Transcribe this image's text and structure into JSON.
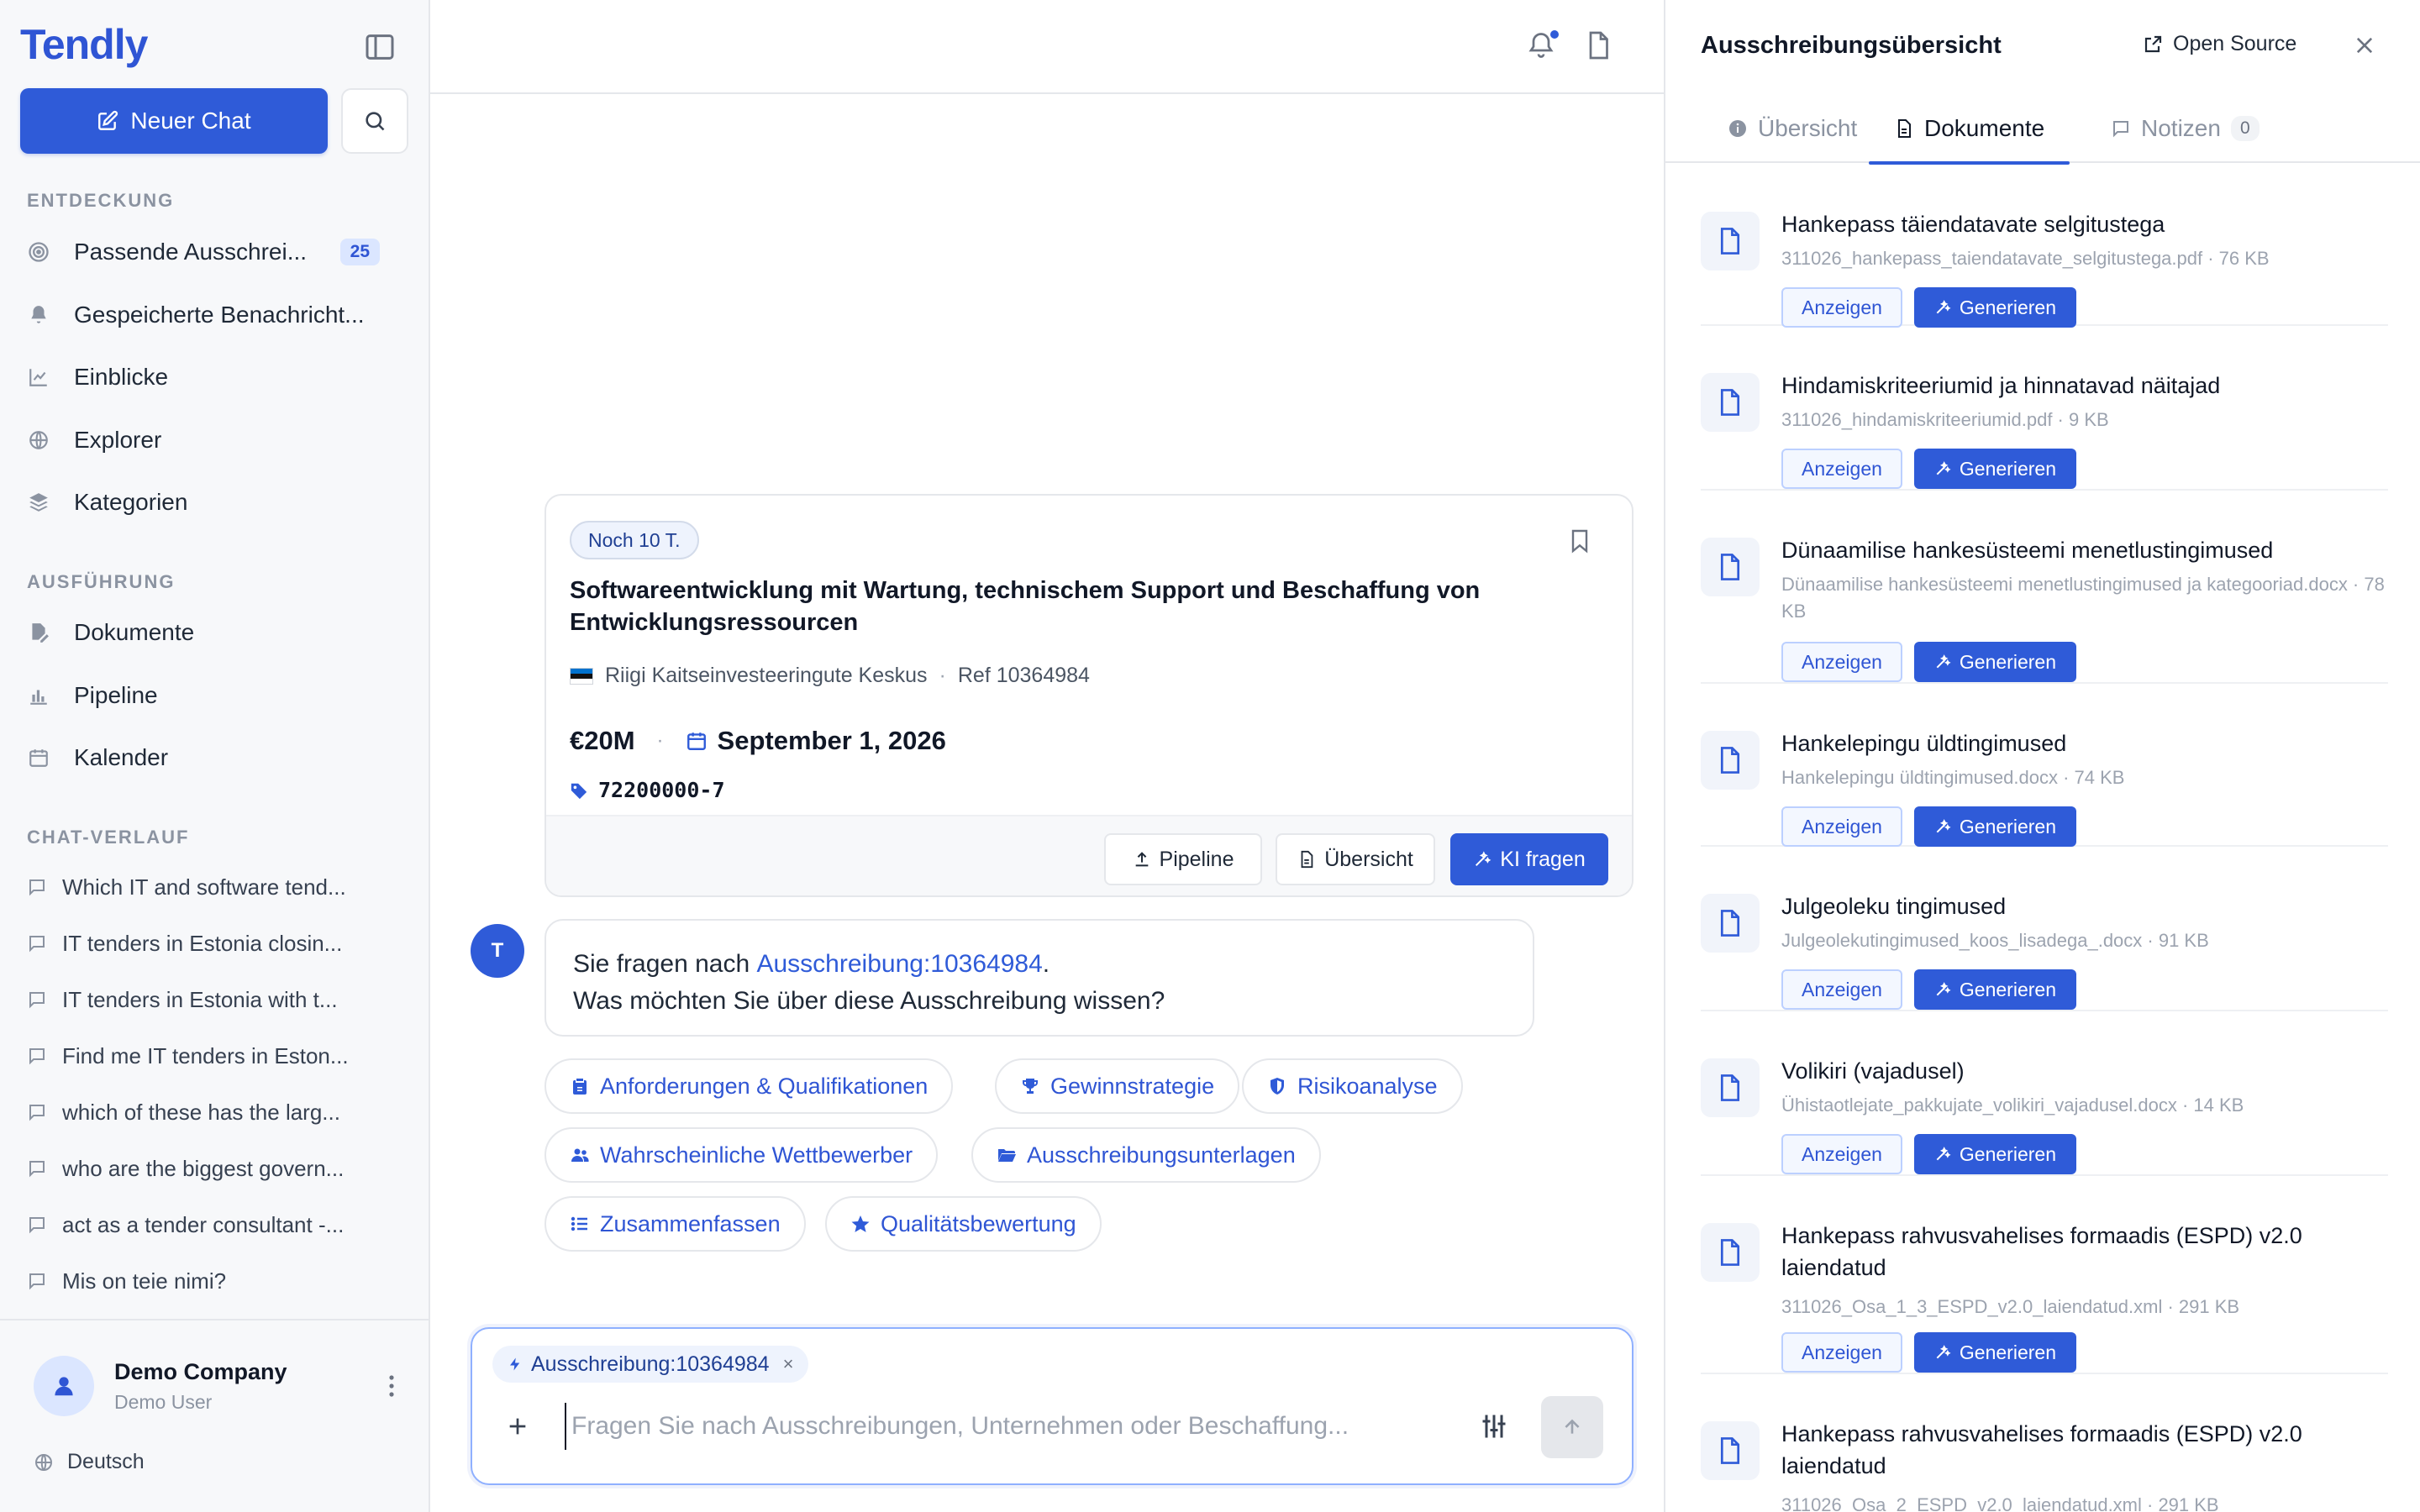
{
  "sidebar": {
    "logo": "Tendly",
    "new_chat_label": "Neuer Chat",
    "sections": {
      "discovery": "ENTDECKUNG",
      "execution": "AUSFÜHRUNG",
      "history": "CHAT-VERLAUF"
    },
    "discovery_items": [
      {
        "label": "Passende Ausschrei...",
        "badge": "25",
        "icon": "target-icon"
      },
      {
        "label": "Gespeicherte Benachricht...",
        "icon": "bell-icon"
      },
      {
        "label": "Einblicke",
        "icon": "line-chart-icon"
      },
      {
        "label": "Explorer",
        "icon": "globe-icon"
      },
      {
        "label": "Kategorien",
        "icon": "layers-icon"
      }
    ],
    "execution_items": [
      {
        "label": "Dokumente",
        "icon": "file-edit-icon"
      },
      {
        "label": "Pipeline",
        "icon": "bar-chart-icon"
      },
      {
        "label": "Kalender",
        "icon": "calendar-icon"
      }
    ],
    "history_items": [
      "Which IT and software tend...",
      "IT tenders in Estonia closin...",
      "IT tenders in Estonia with t...",
      "Find me IT tenders in Eston...",
      "which of these has the larg...",
      "who are the biggest govern...",
      "act as a tender consultant -...",
      "Mis on teie nimi?"
    ],
    "footer": {
      "company": "Demo Company",
      "user": "Demo User",
      "language": "Deutsch"
    }
  },
  "tender": {
    "deadline": "Noch 10 T.",
    "title": "Softwareentwicklung mit Wartung, technischem Support und Beschaffung von Entwicklungsressourcen",
    "organization": "Riigi Kaitseinvesteeringute Keskus",
    "ref": "Ref 10364984",
    "value": "€20M",
    "date": "September 1, 2026",
    "cpv": "72200000-7",
    "buttons": {
      "pipeline": "Pipeline",
      "overview": "Übersicht",
      "ask_ai": "KI fragen"
    }
  },
  "message": {
    "avatar": "T",
    "prefix": "Sie fragen nach ",
    "link": "Ausschreibung:10364984",
    "suffix": ".",
    "line2": "Was möchten Sie über diese Ausschreibung wissen?"
  },
  "suggestions": [
    {
      "label": "Anforderungen & Qualifikationen",
      "icon": "clipboard-icon"
    },
    {
      "label": "Gewinnstrategie",
      "icon": "trophy-icon"
    },
    {
      "label": "Risikoanalyse",
      "icon": "shield-icon"
    },
    {
      "label": "Wahrscheinliche Wettbewerber",
      "icon": "users-icon"
    },
    {
      "label": "Ausschreibungsunterlagen",
      "icon": "folder-icon"
    },
    {
      "label": "Zusammenfassen",
      "icon": "list-icon"
    },
    {
      "label": "Qualitätsbewertung",
      "icon": "star-icon"
    }
  ],
  "composer": {
    "context_chip": "Ausschreibung:10364984",
    "placeholder": "Fragen Sie nach Ausschreibungen, Unternehmen oder Beschaffung..."
  },
  "panel": {
    "title": "Ausschreibungsübersicht",
    "open_source": "Open Source",
    "tabs": {
      "overview": "Übersicht",
      "documents": "Dokumente",
      "notes": "Notizen",
      "notes_count": "0"
    },
    "view_label": "Anzeigen",
    "generate_label": "Generieren",
    "documents": [
      {
        "title": "Hankepass täiendatavate selgitustega",
        "meta": "311026_hankepass_taiendatavate_selgitustega.pdf · 76 KB"
      },
      {
        "title": "Hindamiskriteeriumid ja hinnatavad näitajad",
        "meta": "311026_hindamiskriteeriumid.pdf · 9 KB"
      },
      {
        "title": "Dünaamilise hankesüsteemi menetlustingimused",
        "meta": "Dünaamilise hankesüsteemi menetlustingimused ja kategooriad.docx · 78 KB"
      },
      {
        "title": "Hankelepingu üldtingimused",
        "meta": "Hankelepingu üldtingimused.docx · 74 KB"
      },
      {
        "title": "Julgeoleku tingimused",
        "meta": "Julgeolekutingimused_koos_lisadega_.docx · 91 KB"
      },
      {
        "title": "Volikiri (vajadusel)",
        "meta": "Ühistaotlejate_pakkujate_volikiri_vajadusel.docx · 14 KB"
      },
      {
        "title": "Hankepass rahvusvahelises formaadis (ESPD) v2.0 laiendatud",
        "meta": "311026_Osa_1_3_ESPD_v2.0_laiendatud.xml · 291 KB"
      },
      {
        "title": "Hankepass rahvusvahelises formaadis (ESPD) v2.0 laiendatud",
        "meta": "311026_Osa_2_ESPD_v2.0_laiendatud.xml · 291 KB"
      }
    ]
  }
}
